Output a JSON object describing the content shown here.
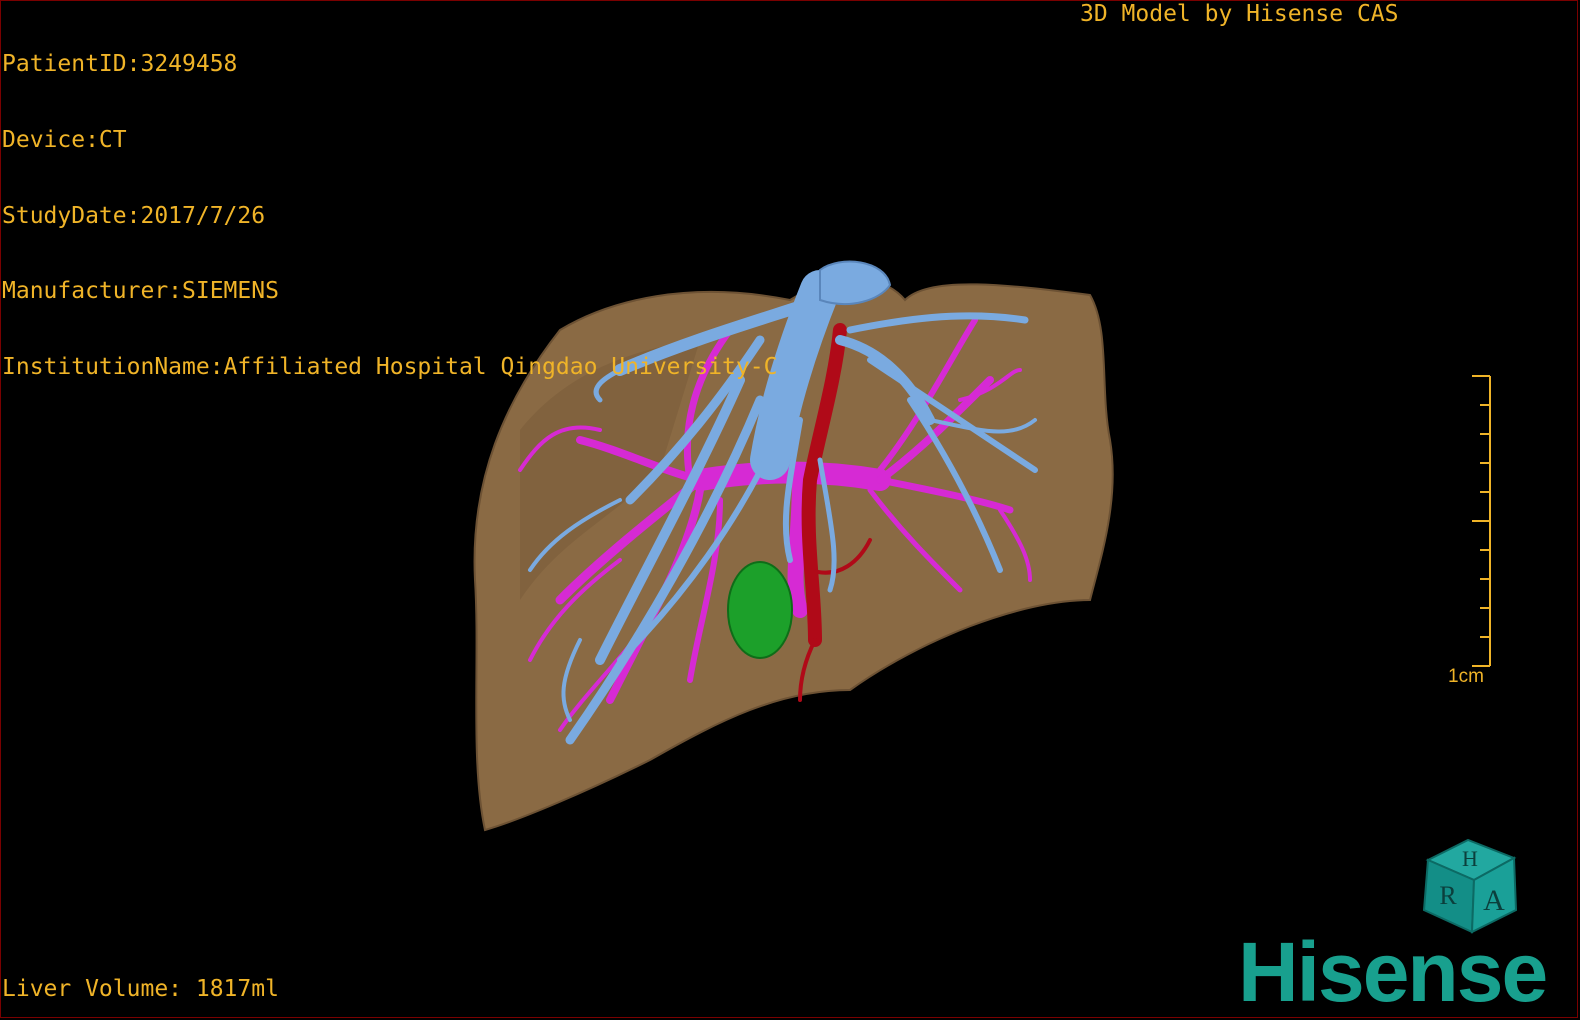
{
  "overlay": {
    "patient_id": "PatientID:3249458",
    "device": "Device:CT",
    "study_date": "StudyDate:2017/7/26",
    "manufacturer": "Manufacturer:SIEMENS",
    "institution": "InstitutionName:Affiliated Hospital Qingdao University-C",
    "model_credit": "3D Model by Hisense CAS",
    "liver_volume": "Liver Volume: 1817ml"
  },
  "scale": {
    "label": "1cm"
  },
  "orientation_cube": {
    "icon": "orientation-cube-icon",
    "faces": {
      "top": "H",
      "left": "R",
      "front": "A"
    }
  },
  "logo": {
    "text": "Hisense"
  },
  "colors": {
    "text": "#f0b428",
    "liver": "#8a6a44",
    "hepatic_vein": "#7aaae0",
    "portal_vein": "#d62ad4",
    "artery": "#b00a18",
    "gallbladder": "#1ca02a",
    "brand": "#18a08e"
  }
}
